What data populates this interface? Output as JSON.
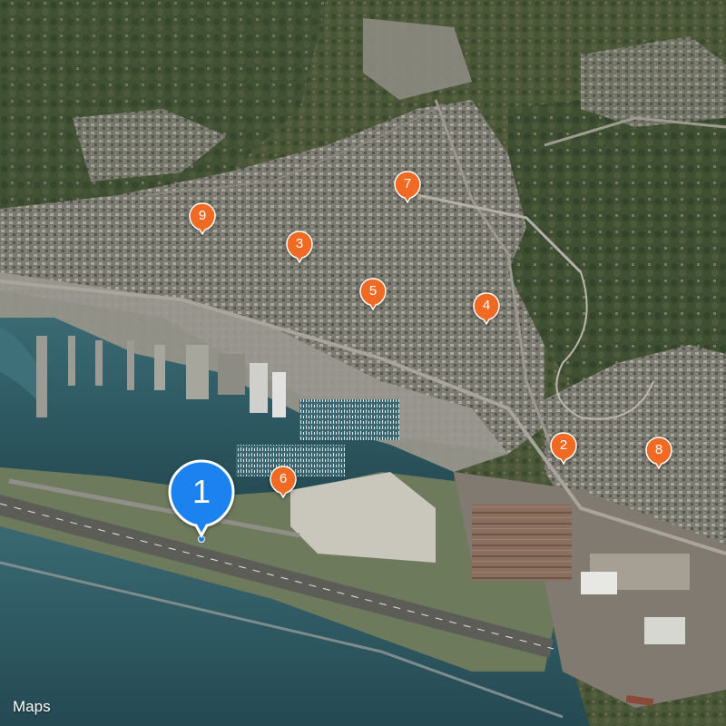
{
  "map": {
    "type": "satellite",
    "provider_logo": {
      "icon": "apple-logo-icon",
      "glyph": "",
      "label": "Maps"
    }
  },
  "colors": {
    "sea": "#2f5c66",
    "pin_orange": "#f06a24",
    "pin_blue": "#1b82f0",
    "land": "#6b6a5e",
    "vegetation": "#3e4d33"
  },
  "selected_pin": {
    "label": "1"
  },
  "pins": [
    {
      "label": "2"
    },
    {
      "label": "3"
    },
    {
      "label": "4"
    },
    {
      "label": "5"
    },
    {
      "label": "6"
    },
    {
      "label": "7"
    },
    {
      "label": "8"
    },
    {
      "label": "9"
    }
  ]
}
